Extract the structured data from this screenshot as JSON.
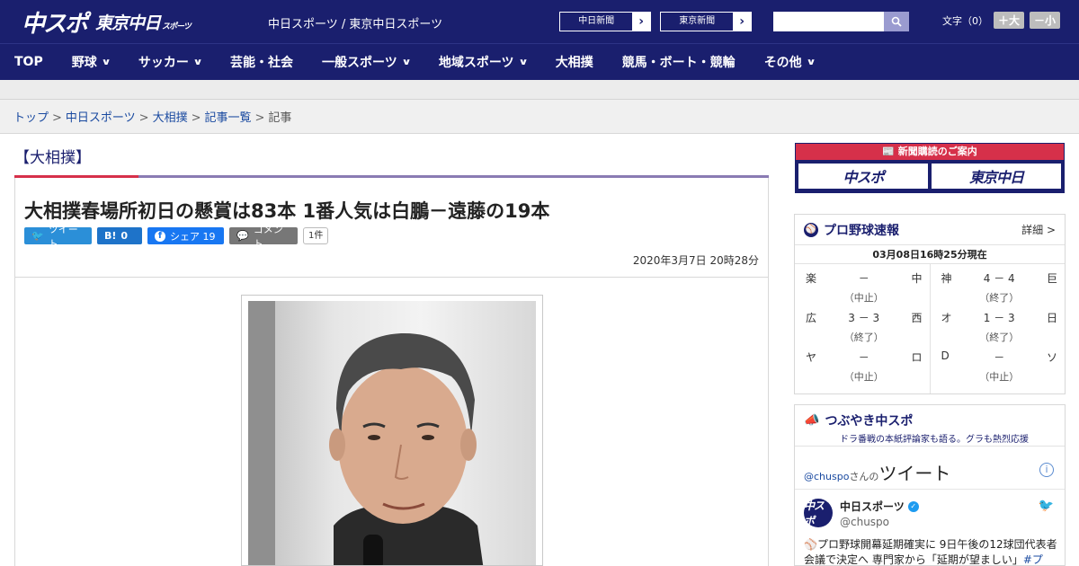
{
  "header": {
    "logo_main": "中スポ",
    "logo_sub": "東京中日",
    "logo_sub_small": "スポーツ",
    "site_links": "中日スポーツ / 東京中日スポーツ",
    "paper_buttons": [
      {
        "label": "中日新聞",
        "arrow": "›"
      },
      {
        "label": "東京新聞",
        "arrow": "›"
      }
    ],
    "search_placeholder": "",
    "font_size_label": "文字（0）",
    "font_plus": "＋大",
    "font_minus": "－小"
  },
  "nav": {
    "items": [
      {
        "label": "TOP",
        "dropdown": false
      },
      {
        "label": "野球",
        "dropdown": true
      },
      {
        "label": "サッカー",
        "dropdown": true
      },
      {
        "label": "芸能・社会",
        "dropdown": false
      },
      {
        "label": "一般スポーツ",
        "dropdown": true
      },
      {
        "label": "地域スポーツ",
        "dropdown": true
      },
      {
        "label": "大相撲",
        "dropdown": false
      },
      {
        "label": "競馬・ボート・競輪",
        "dropdown": false
      },
      {
        "label": "その他",
        "dropdown": true
      }
    ]
  },
  "breadcrumb": {
    "items": [
      "トップ",
      "中日スポーツ",
      "大相撲",
      "記事一覧"
    ],
    "current": "記事",
    "separator": ">"
  },
  "article": {
    "category": "【大相撲】",
    "headline": "大相撲春場所初日の懸賞は83本 1番人気は白鵬－遠藤の19本",
    "social": {
      "tweet": "ツイート",
      "hatena": "0",
      "facebook": "シェア 19",
      "comment": "コメント",
      "comment_count": "1件"
    },
    "date": "2020年3月7日 20時28分"
  },
  "sidebar": {
    "promo": {
      "title": "新聞購読のご案内",
      "btn1": "中スポ",
      "btn2": "東京中日"
    },
    "scores": {
      "title": "プロ野球速報",
      "more": "詳細 >",
      "timestamp": "03月08日16時25分現在",
      "games": [
        {
          "home": "楽",
          "score": "－",
          "away": "中",
          "status": "（中止）"
        },
        {
          "home": "神",
          "score": "4 － 4",
          "away": "巨",
          "status": "（終了）"
        },
        {
          "home": "広",
          "score": "3 － 3",
          "away": "西",
          "status": "（終了）"
        },
        {
          "home": "オ",
          "score": "1 － 3",
          "away": "日",
          "status": "（終了）"
        },
        {
          "home": "ヤ",
          "score": "－",
          "away": "ロ",
          "status": "（中止）"
        },
        {
          "home": "D",
          "score": "－",
          "away": "ソ",
          "status": "（中止）"
        }
      ]
    },
    "twitter": {
      "title": "つぶやき中スポ",
      "subtitle": "ドラ番戦の本紙評論家も語る。グラも熱烈応援",
      "handle_link": "@chuspo",
      "handle_suffix": "さんの",
      "heading": "ツイート",
      "account_name": "中日スポーツ",
      "account_handle": "@chuspo",
      "avatar_text": "中スポ",
      "tweet_text": "⚾プロ野球開幕延期確実に 9日午後の12球団代表者会議で決定へ 専門家から「延期が望ましい」",
      "tweet_tag": "#プ"
    }
  }
}
